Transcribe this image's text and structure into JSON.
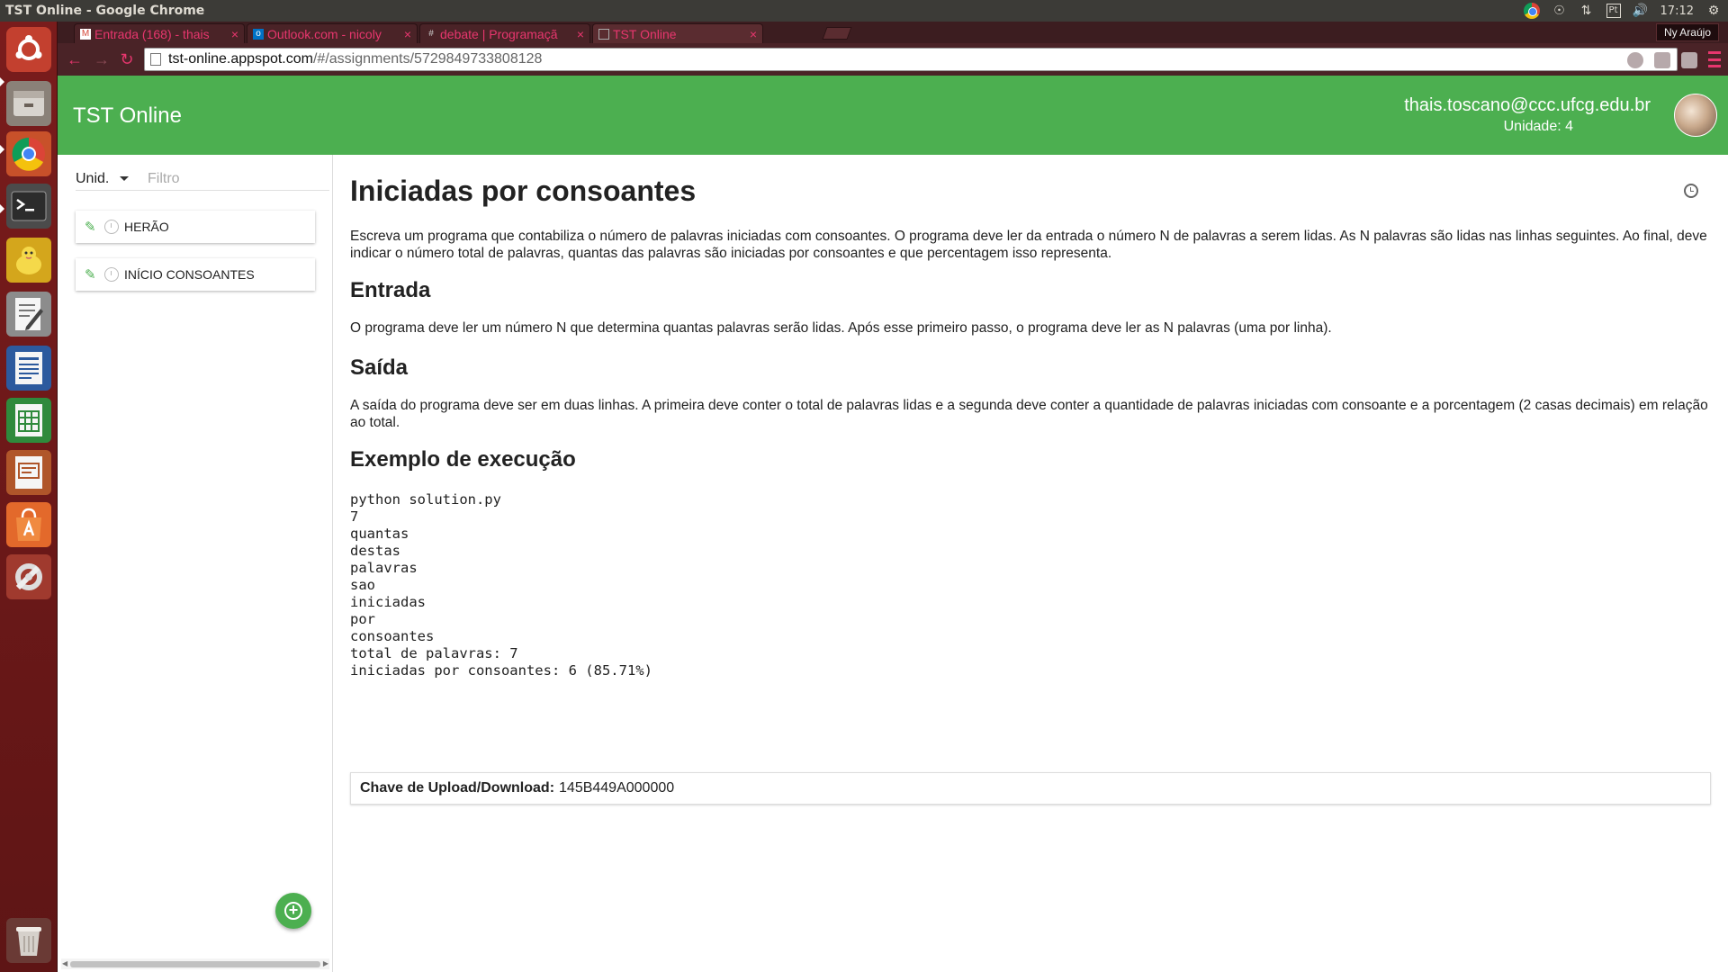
{
  "window": {
    "title": "TST Online - Google Chrome"
  },
  "tray": {
    "keyboard": "Pt",
    "clock": "17:12"
  },
  "tabs": [
    {
      "label": "Entrada (168) - thais",
      "favicon": "gmail-icon"
    },
    {
      "label": "Outlook.com - nicoly",
      "favicon": "outlook-icon"
    },
    {
      "label": "debate | Programaçã",
      "favicon": "hash-icon"
    },
    {
      "label": "TST Online",
      "favicon": "page-icon"
    }
  ],
  "profile": {
    "name": "Ny Araújo"
  },
  "address": {
    "host": "tst-online.appspot.com",
    "path": "/#/assignments/5729849733808128"
  },
  "header": {
    "brand": "TST Online",
    "email": "thais.toscano@ccc.ufcg.edu.br",
    "unit": "Unidade: 4"
  },
  "sidebar": {
    "unit_label": "Unid.",
    "filter_placeholder": "Filtro",
    "items": [
      {
        "label": "HERÃO"
      },
      {
        "label": "INÍCIO CONSOANTES"
      }
    ]
  },
  "assignment": {
    "title": "Iniciadas por consoantes",
    "description": "Escreva um programa que contabiliza o número de palavras iniciadas com consoantes. O programa deve ler da entrada o número N de palavras a serem lidas. As N palavras são lidas nas linhas seguintes. Ao final, deve indicar o número total de palavras, quantas das palavras são iniciadas por consoantes e que percentagem isso representa.",
    "input_heading": "Entrada",
    "input_text": "O programa deve ler um número N que determina quantas palavras serão lidas. Após esse primeiro passo, o programa deve ler as N palavras (uma por linha).",
    "output_heading": "Saída",
    "output_text": "A saída do programa deve ser em duas linhas. A primeira deve conter o total de palavras lidas e a segunda deve conter a quantidade de palavras iniciadas com consoante e a porcentagem (2 casas decimais) em relação ao total.",
    "example_heading": "Exemplo de execução",
    "example_code": "python solution.py\n7\nquantas\ndestas\npalavras\nsao\niniciadas\npor\nconsoantes\ntotal de palavras: 7\niniciadas por consoantes: 6 (85.71%)",
    "key_label": "Chave de Upload/Download:",
    "key_value": "145B449A000000"
  },
  "colors": {
    "accent": "#4caf50",
    "launcher": "#6b1a1a",
    "tab_text": "#e8366e"
  }
}
